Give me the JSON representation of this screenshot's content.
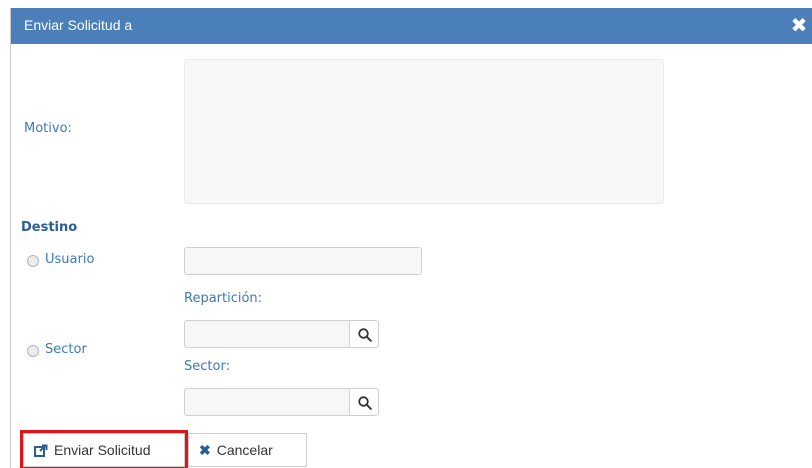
{
  "dialog": {
    "title": "Enviar Solicitud a",
    "close_icon": "close-icon"
  },
  "form": {
    "motivo_label": "Motivo:",
    "destino_heading": "Destino",
    "usuario_label": "Usuario",
    "sector_label": "Sector",
    "reparticion_label": "Repartición:",
    "sector_field_label": "Sector:"
  },
  "buttons": {
    "send_label": "Enviar Solicitud",
    "send_icon": "share-icon",
    "cancel_label": "Cancelar",
    "cancel_icon": "x-icon"
  },
  "colors": {
    "titlebar": "#4a7fba",
    "label": "#3d7ab8",
    "highlight": "#e0131c"
  }
}
